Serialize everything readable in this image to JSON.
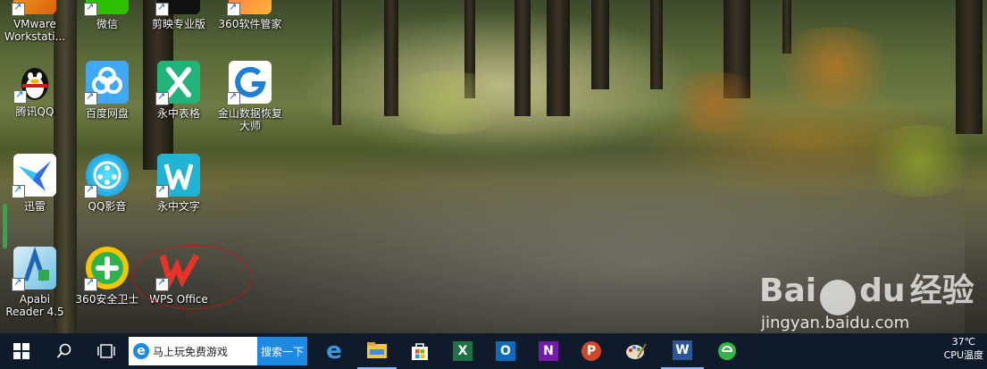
{
  "desktop": {
    "icons": [
      {
        "label": "VMware\nWorkstati..."
      },
      {
        "label": "微信"
      },
      {
        "label": "剪映专业版"
      },
      {
        "label": "360软件管家"
      },
      {
        "label": "腾讯QQ"
      },
      {
        "label": "百度网盘"
      },
      {
        "label": "永中表格"
      },
      {
        "label": "金山数据恢复\n大师"
      },
      {
        "label": "迅雷"
      },
      {
        "label": "QQ影音"
      },
      {
        "label": "永中文字"
      },
      {
        "label": "Apabi\nReader 4.5"
      },
      {
        "label": "360安全卫士"
      },
      {
        "label": "WPS Office"
      }
    ]
  },
  "watermark": {
    "brand_left": "Bai",
    "brand_right": "du",
    "brand_cn": "经验",
    "url": "jingyan.baidu.com"
  },
  "taskbar": {
    "search_text": "马上玩免费游戏",
    "search_button": "搜索一下",
    "apps": [
      {
        "icon": "edge-icon"
      },
      {
        "icon": "file-explorer-icon"
      },
      {
        "icon": "store-icon"
      },
      {
        "icon": "excel-icon"
      },
      {
        "icon": "outlook-icon"
      },
      {
        "icon": "onenote-icon"
      },
      {
        "icon": "powerpoint-icon"
      },
      {
        "icon": "paint-icon"
      },
      {
        "icon": "word-icon"
      },
      {
        "icon": "green-browser-icon"
      }
    ],
    "tray_temp": "37℃",
    "tray_label": "CPU温度"
  },
  "colors": {
    "taskbar": "#0f1b2a",
    "annotation": "#c01818",
    "search_button": "#1e88e5"
  }
}
